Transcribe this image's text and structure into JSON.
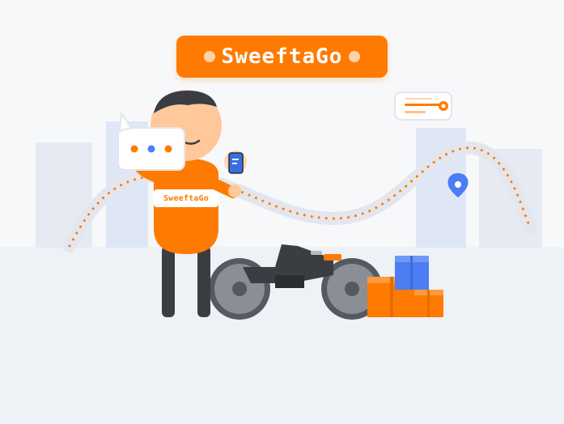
{
  "brand": {
    "logo_text": "SweeftaGo",
    "shirt_text": "SweeftaGo",
    "accent_color": "#ff7a00"
  },
  "icons": [
    "chat-bubble-icon",
    "phone-icon",
    "location-pin-icon",
    "slider-card-icon",
    "box-icon"
  ]
}
